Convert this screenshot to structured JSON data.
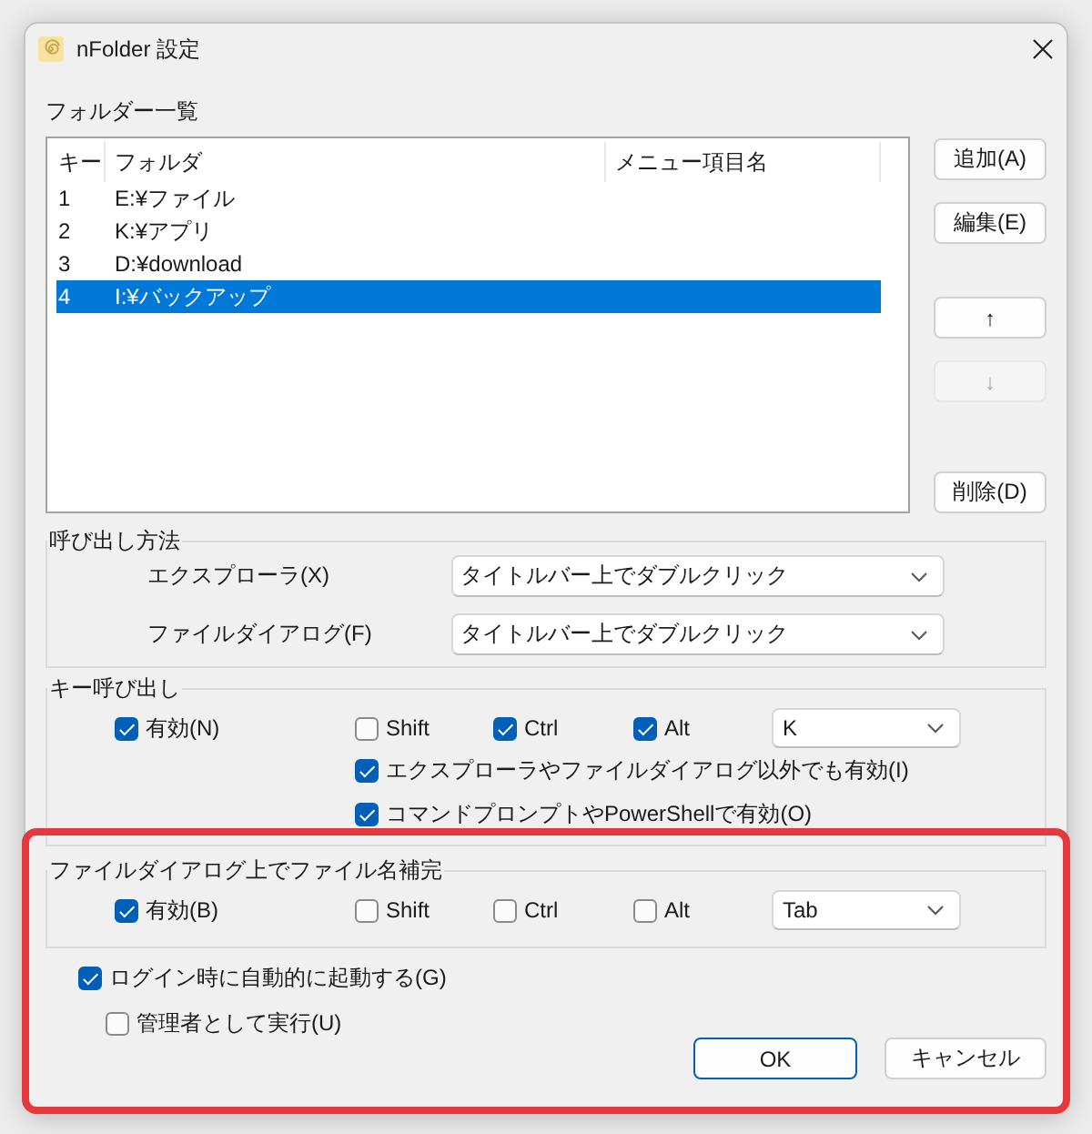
{
  "window": {
    "title": "nFolder 設定"
  },
  "folder_list": {
    "label": "フォルダー一覧",
    "columns": [
      "キー",
      "フォルダ",
      "メニュー項目名"
    ],
    "rows": [
      {
        "key": "1",
        "folder": "E:¥ファイル",
        "selected": false
      },
      {
        "key": "2",
        "folder": "K:¥アプリ",
        "selected": false
      },
      {
        "key": "3",
        "folder": "D:¥download",
        "selected": false
      },
      {
        "key": "4",
        "folder": "I:¥バックアップ",
        "selected": true
      }
    ]
  },
  "list_buttons": [
    [
      {
        "label": "追加(A)",
        "disabled": false
      },
      {
        "label": "編集(E)",
        "disabled": false
      }
    ],
    [
      {
        "label": "↑",
        "disabled": false
      },
      {
        "label": "↓",
        "disabled": true
      }
    ],
    [
      {
        "label": "削除(D)",
        "disabled": false
      }
    ]
  ],
  "invoke_method": {
    "title": "呼び出し方法",
    "rows": [
      {
        "label": "エクスプローラ(X)",
        "value": "タイトルバー上でダブルクリック"
      },
      {
        "label": "ファイルダイアログ(F)",
        "value": "タイトルバー上でダブルクリック"
      }
    ]
  },
  "key_invoke": {
    "title": "キー呼び出し",
    "enabled": {
      "label": "有効(N)",
      "checked": true
    },
    "modifiers": [
      {
        "label": "Shift",
        "checked": false
      },
      {
        "label": "Ctrl",
        "checked": true
      },
      {
        "label": "Alt",
        "checked": true
      }
    ],
    "key": "K",
    "options": [
      {
        "label": "エクスプローラやファイルダイアログ以外でも有効(I)",
        "checked": true
      },
      {
        "label": "コマンドプロンプトやPowerShellで有効(O)",
        "checked": true
      }
    ]
  },
  "completion": {
    "title": "ファイルダイアログ上でファイル名補完",
    "enabled": {
      "label": "有効(B)",
      "checked": true
    },
    "modifiers": [
      {
        "label": "Shift",
        "checked": false
      },
      {
        "label": "Ctrl",
        "checked": false
      },
      {
        "label": "Alt",
        "checked": false
      }
    ],
    "key": "Tab"
  },
  "startup": {
    "label": "ログイン時に自動的に起動する(G)",
    "checked": true,
    "children": [
      {
        "label": "管理者として実行(U)",
        "checked": false
      }
    ]
  },
  "buttons": [
    {
      "label": "OK",
      "default": true
    },
    {
      "label": "キャンセル",
      "default": false
    }
  ]
}
